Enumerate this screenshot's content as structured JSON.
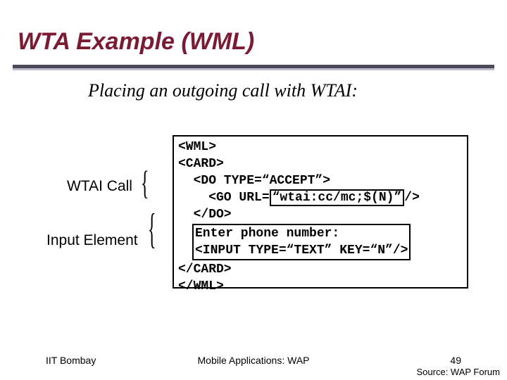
{
  "title": "WTA Example (WML)",
  "subtitle": "Placing an outgoing call with WTAI:",
  "labels": {
    "wtai_call": "WTAI Call",
    "input_element": "Input Element"
  },
  "code": {
    "l1": "<WML>",
    "l2": "<CARD>",
    "l3_a": "  <DO TYPE=“ACCEPT”>",
    "l4_a": "    <GO URL=",
    "l4_hl": "“wtai:cc/mc;$(N)”",
    "l4_b": "/>",
    "l5": "  </DO>",
    "l6_hl_a": "Enter phone number:",
    "l7_hl_a": "<INPUT TYPE=“TEXT” KEY=“N”/>",
    "l8": "</CARD>",
    "l9": "</WML>"
  },
  "footer": {
    "left": "IIT Bombay",
    "center": "Mobile Applications: WAP",
    "page": "49",
    "source": "Source: WAP Forum"
  }
}
